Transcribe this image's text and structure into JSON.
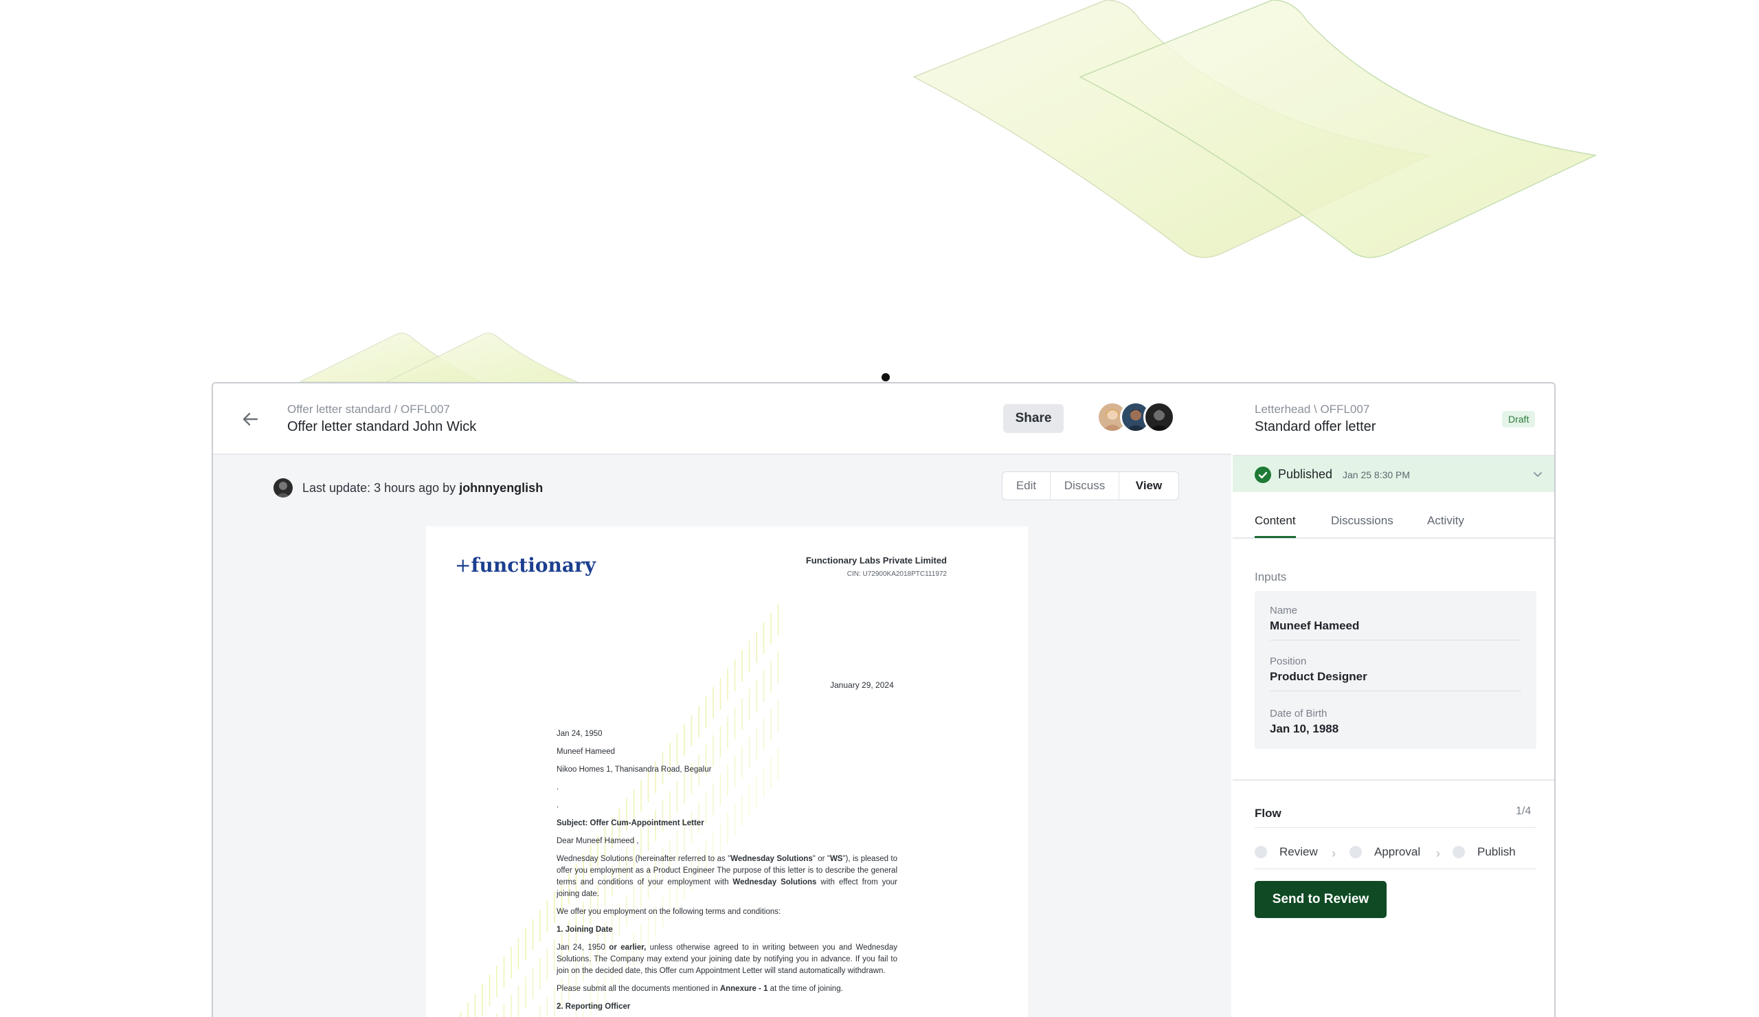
{
  "header": {
    "breadcrumb": "Offer letter standard / OFFL007",
    "title": "Offer letter standard John Wick",
    "share_label": "Share",
    "back_icon": "arrow-left-icon"
  },
  "toolbar": {
    "last_update_prefix": "Last update: 3 hours ago by",
    "last_update_user": "johnnyenglish",
    "modes": [
      "Edit",
      "Discuss",
      "View"
    ],
    "active_mode": "View"
  },
  "document": {
    "logo_text": "functionary",
    "company": "Functionary Labs Private Limited",
    "cin": "CIN: U72900KA2018PTC111972",
    "date": "January 29, 2024",
    "lines": {
      "l1": "Jan 24, 1950",
      "l2": "Muneef Hameed",
      "l3": "Nikoo Homes 1, Thanisandra Road, Begalur",
      "l4": ".",
      "l5": ".",
      "subject": "Subject: Offer Cum-Appointment Letter",
      "greeting": "Dear Muneef Hameed ,",
      "p1a": "Wednesday Solutions (hereinafter referred to as \"",
      "p1b": "Wednesday Solutions",
      "p1c": "\" or \"",
      "p1d": "WS",
      "p1e": "\"), is pleased to offer you employment as a Product Engineer The purpose of this letter is to describe the general terms and conditions of your employment with ",
      "p1f": "Wednesday Solutions",
      "p1g": " with effect from your joining date.",
      "p2": "We offer you employment on the following terms and conditions:",
      "h1": "1. Joining Date",
      "p3a": "Jan 24, 1950 ",
      "p3b": "or earlier,",
      "p3c": " unless otherwise agreed to in writing between you and Wednesday Solutions. The Company may extend your joining date by notifying you in advance. If you fail to join on the decided date, this Offer cum Appointment Letter will stand automatically withdrawn.",
      "p4a": "Please submit all the documents mentioned in ",
      "p4b": "Annexure - 1",
      "p4c": " at the time of joining.",
      "h2": "2. Reporting Officer"
    }
  },
  "side": {
    "breadcrumb": "Letterhead \\ OFFL007",
    "title": "Standard offer letter",
    "status_badge": "Draft",
    "published_label": "Published",
    "published_date": "Jan 25 8:30 PM",
    "tabs": [
      "Content",
      "Discussions",
      "Activity"
    ],
    "active_tab": "Content",
    "inputs_label": "Inputs",
    "fields": [
      {
        "label": "Name",
        "value": "Muneef Hameed"
      },
      {
        "label": "Position",
        "value": "Product Designer"
      },
      {
        "label": "Date of Birth",
        "value": "Jan 10, 1988"
      }
    ],
    "flow_label": "Flow",
    "flow_count": "1/4",
    "steps": [
      "Review",
      "Approval",
      "Publish"
    ],
    "send_label": "Send to Review"
  },
  "colors": {
    "accent_green": "#0f4a24",
    "published_bg": "#e3f4e6",
    "logo_blue": "#1c3f8f",
    "stripe_yellow": "#e4ea7c"
  }
}
